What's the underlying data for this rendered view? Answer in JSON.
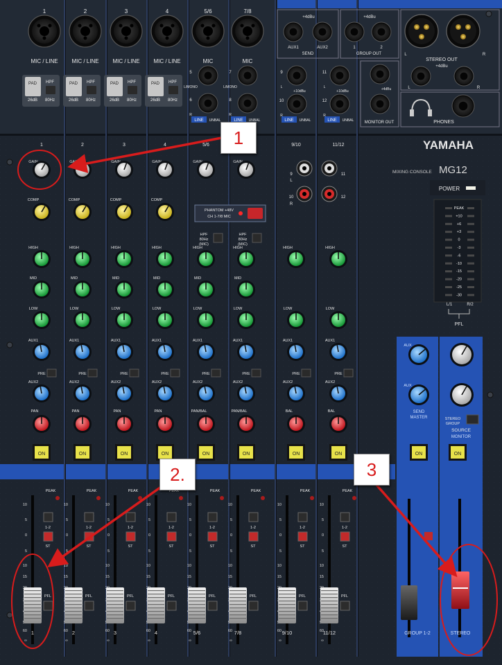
{
  "brand": {
    "name": "YAMAHA",
    "mixing_label": "MIXING CONSOLE",
    "model": "MG12"
  },
  "inputs": {
    "channel_numbers": [
      "1",
      "2",
      "3",
      "4",
      "5/6",
      "7/8"
    ],
    "labels": [
      "MIC / LINE",
      "MIC / LINE",
      "MIC / LINE",
      "MIC / LINE",
      "MIC",
      "MIC"
    ],
    "pad": "PAD",
    "pad_value": "26dB",
    "hpf": "HPF",
    "hpf_value": "80Hz",
    "mono_jack_labels": [
      "5",
      "L/MONO",
      "6",
      "R",
      "7",
      "L/MONO",
      "8",
      "R"
    ],
    "line_tag": "LINE",
    "unbal": "UNBAL",
    "stereo_jack_labels": [
      "9",
      "L",
      "10",
      "R",
      "11",
      "L",
      "12",
      "R"
    ],
    "level": "+10dBu"
  },
  "outputs": {
    "send_level": "+4dBu",
    "aux1": "AUX1",
    "aux2": "AUX2",
    "send": "SEND",
    "group_level": "+4dBu",
    "group_1": "1",
    "group_2": "2",
    "group_out": "GROUP OUT",
    "stereo_out": "STEREO OUT",
    "stereo_level": "+4dBu",
    "l": "L",
    "r": "R",
    "monitor_level": "+4dBu",
    "monitor_out": "MONITOR OUT",
    "phones": "PHONES"
  },
  "strip_numbers": [
    "1",
    "2",
    "3",
    "4",
    "5/6",
    "7/8",
    "9/10",
    "11/12"
  ],
  "controls": {
    "gain": "GAIN",
    "comp": "COMP",
    "high": "HIGH",
    "mid": "MID",
    "low": "LOW",
    "aux1": "AUX1",
    "aux2": "AUX2",
    "pan": "PAN",
    "pan_bal": "PAN/BAL",
    "bal": "BAL",
    "pre": "PRE",
    "on": "ON",
    "peak": "PEAK",
    "pfl": "PFL",
    "bus_12": "1-2",
    "st": "ST",
    "hpf_mic": [
      "HPF",
      "80Hz",
      "(MIC)"
    ],
    "phantom": [
      "PHANTOM +48V",
      "CH 1-7/8 MIC"
    ],
    "rca_labels": [
      "9",
      "L",
      "11",
      "10",
      "R",
      "12"
    ]
  },
  "master": {
    "power": "POWER",
    "meter_scale": [
      "PEAK",
      "+10",
      "+6",
      "+3",
      "0",
      "-3",
      "-6",
      "-10",
      "-15",
      "-20",
      "-25",
      "-30"
    ],
    "meter_lr": [
      "L/1",
      "R/2"
    ],
    "pfl": "PFL",
    "aux_label": "AUX",
    "send_master": [
      "SEND",
      "MASTER"
    ],
    "stereo_group": [
      "STEREO",
      "GROUP"
    ],
    "source": "SOURCE",
    "monitor": "MONITOR",
    "group_on": "ON",
    "stereo_on": "ON",
    "group_label": "GROUP 1-2",
    "stereo_label": "STEREO"
  },
  "fader_scale": [
    "10",
    "5",
    "0",
    "5",
    "10",
    "15",
    "20",
    "30",
    "40",
    "50",
    "60",
    "∞"
  ],
  "callouts": [
    "1",
    "2.",
    "3"
  ],
  "colors": {
    "panel": "#1d242e",
    "blue": "#2553b4",
    "red_annotation": "#d81c1c",
    "on_button": "#e8e24a"
  }
}
